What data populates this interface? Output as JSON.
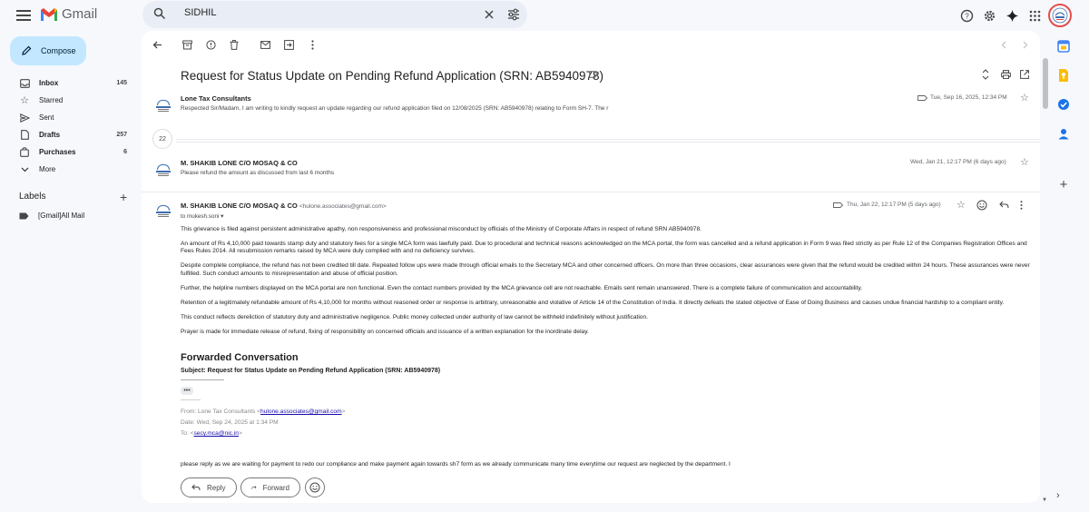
{
  "app": {
    "name": "Gmail"
  },
  "search": {
    "value": "SIDHIL"
  },
  "compose": {
    "label": "Compose"
  },
  "nav": [
    {
      "label": "Inbox",
      "count": "145",
      "bold": true
    },
    {
      "label": "Starred",
      "count": ""
    },
    {
      "label": "Sent",
      "count": ""
    },
    {
      "label": "Drafts",
      "count": "257",
      "bold": true
    },
    {
      "label": "Purchases",
      "count": "6",
      "bold": true
    },
    {
      "label": "More",
      "count": ""
    }
  ],
  "labels": {
    "heading": "Labels",
    "items": [
      "[Gmail]All Mail"
    ]
  },
  "thread": {
    "subject": "Request for Status Update on Pending Refund Application (SRN: AB5940978)",
    "collapsed_count": "22",
    "messages": [
      {
        "sender": "Lone Tax Consultants",
        "snippet": "Respected Sir/Madam, I am writing to kindly request an update regarding our refund application filed on 12/08/2025 (SRN: AB5940978) relating to Form SH-7. The r",
        "date": "Tue, Sep 16, 2025, 12:34 PM"
      },
      {
        "sender": "M. SHAKIB LONE C/O MOSAQ & CO",
        "snippet": "Please refund the amount as discussed from last 6 months",
        "date": "Wed, Jan 21, 12:17 PM (6 days ago)"
      }
    ],
    "open": {
      "sender": "M. SHAKIB LONE C/O MOSAQ & CO",
      "email": "<hulone.associates@gmail.com>",
      "to": "to mukesh.soni",
      "date": "Thu, Jan 22, 12:17 PM (5 days ago)",
      "paragraphs": [
        "This grievance is filed against persistent administrative apathy, non responsiveness and professional misconduct by officials of the Ministry of Corporate Affairs in respect of refund SRN AB5940978.",
        "An amount of Rs 4,10,000 paid towards stamp duty and statutory fees for a single MCA form was lawfully paid. Due to procedural and technical reasons acknowledged on the MCA portal, the form was cancelled and a refund application in Form 9 was filed strictly as per Rule 12 of the Companies Registration Offices and Fees Rules 2014. All resubmission remarks raised by MCA were duly complied with and no deficiency survives.",
        "Despite complete compliance, the refund has not been credited till date. Repeated follow ups were made through official emails to the Secretary MCA and other concerned officers. On more than three occasions, clear assurances were given that the refund would be credited within 24 hours. These assurances were never fulfilled. Such conduct amounts to misrepresentation and abuse of official position.",
        "Further, the helpline numbers displayed on the MCA portal are non functional. Even the contact numbers provided by the MCA grievance cell are not reachable. Emails sent remain unanswered. There is a complete failure of communication and accountability.",
        "Retention of a legitimately refundable amount of Rs 4,10,000 for months without reasoned order or response is arbitrary, unreasonable and violative of Article 14 of the Constitution of India. It directly defeats the stated objective of Ease of Doing Business and causes undue financial hardship to a compliant entity.",
        "This conduct reflects dereliction of statutory duty and administrative negligence. Public money collected under authority of law cannot be withheld indefinitely without justification.",
        "Prayer is made for immediate release of refund, fixing of responsibility on concerned officials and issuance of a written explanation for the inordinate delay."
      ],
      "forwarded": {
        "title": "Forwarded Conversation",
        "subject": "Subject: Request for Status Update on Pending Refund Application (SRN: AB5940978)",
        "dash": "------------------------",
        "dots": "•••",
        "dash2": "-----------",
        "from_prefix": "From: Lone Tax Consultants <",
        "from_email": "hulone.associates@gmail.com",
        "from_suffix": ">",
        "date": "Date: Wed, Sep 24, 2025 at 1:34 PM",
        "to_prefix": "To: <",
        "to_email": "secy.mca@nic.in",
        "to_suffix": ">"
      },
      "tail": "please reply as we are waiting for payment to redo our compliance and make payment again towards sh7 form as we already communicate many time everytime our request are neglected by the department. I"
    }
  },
  "actions": {
    "reply": "Reply",
    "forward": "Forward"
  },
  "colors": {
    "compose_bg": "#c2e7ff",
    "search_bg": "#e9eef6",
    "page_bg": "#f6f8fc"
  }
}
